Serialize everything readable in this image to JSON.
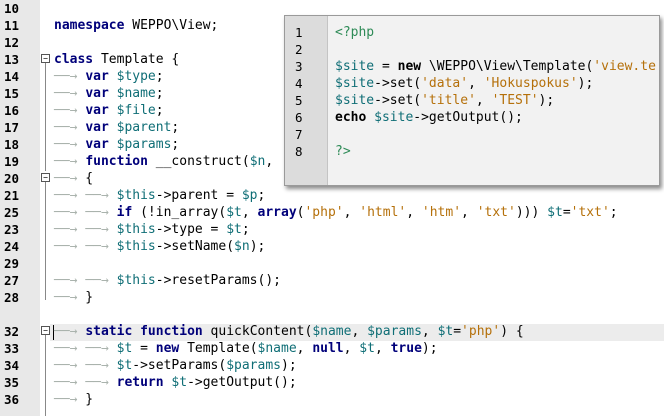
{
  "editor": {
    "line_numbers": [
      "10",
      "11",
      "12",
      "13",
      "14",
      "15",
      "16",
      "17",
      "18",
      "19",
      "20",
      "21",
      "25",
      "23",
      "24",
      "29",
      "27",
      "28",
      "32",
      "33",
      "34",
      "35",
      "36"
    ],
    "lines": [
      "",
      "namespace WEPPO\\View;",
      "",
      "class Template {",
      "    var $type;",
      "    var $name;",
      "    var $file;",
      "    var $parent;",
      "    var $params;",
      "    function __construct($n, ",
      "    {",
      "        $this->parent = $p;",
      "        if (!in_array($t, array('php', 'html', 'htm', 'txt'))) $t='txt';",
      "        $this->type = $t;",
      "        $this->setName($n);",
      "",
      "        $this->resetParams();",
      "    }",
      "",
      "    static function quickContent($name, $params, $t='php') {",
      "        $t = new Template($name, null, $t, true);",
      "        $t->setParams($params);",
      "        return $t->getOutput();",
      "    }"
    ]
  },
  "popup": {
    "line_numbers": [
      "1",
      "2",
      "3",
      "4",
      "5",
      "6",
      "7",
      "8"
    ],
    "lines": [
      "<?php",
      "",
      "$site = new \\WEPPO\\View\\Template('view.te",
      "$site->set('data', 'Hokuspokus');",
      "$site->set('title', 'TEST');",
      "echo $site->getOutput();",
      "",
      "?>"
    ]
  }
}
